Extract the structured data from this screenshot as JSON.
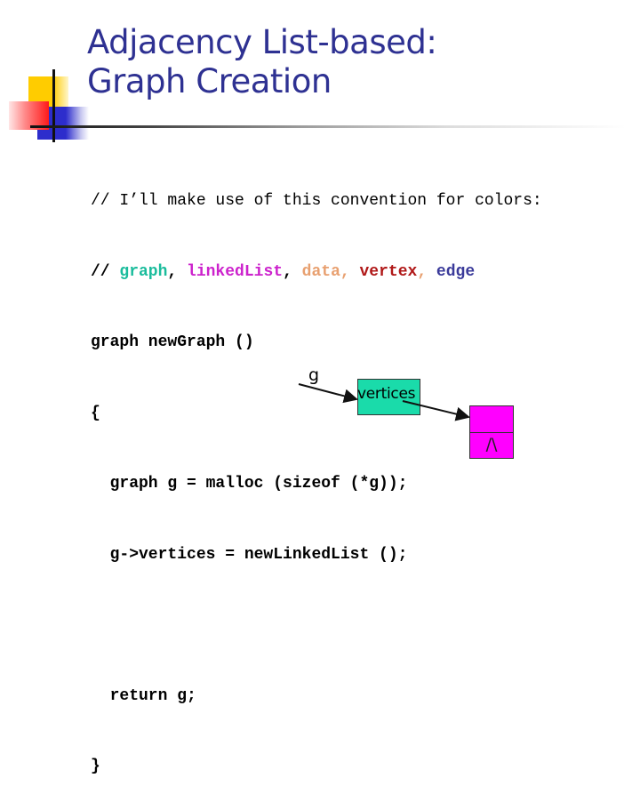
{
  "slide": {
    "title_lines": [
      "Adjacency List-based:",
      "Graph Creation"
    ],
    "colors": {
      "title": "#2e3192",
      "graph": "#1abc9c",
      "linkedList": "#cc22cc",
      "data": "#e8a070",
      "vertex": "#b01818",
      "edge": "#3a3a9a",
      "vertices_box": "#1adbaa",
      "node_box": "#ff00ff"
    },
    "code": {
      "line1": "// I’ll make use of this convention for colors:",
      "line2_prefix": "// ",
      "legend": [
        {
          "text": "graph",
          "sep": ", "
        },
        {
          "text": "linkedList",
          "sep": ", "
        },
        {
          "text": "data",
          "sep": ", "
        },
        {
          "text": "vertex",
          "sep": ", "
        },
        {
          "text": "edge",
          "sep": ""
        }
      ],
      "line3": "graph newGraph ()",
      "line4": "{",
      "line5": "  graph g = malloc (sizeof (*g));",
      "line6": "  g->vertices = newLinkedList ();",
      "line7": "",
      "line8": "  return g;",
      "line9": "}"
    },
    "diagram": {
      "pointer_label": "g",
      "vertices_label": "vertices",
      "null_symbol": "/\\"
    }
  }
}
